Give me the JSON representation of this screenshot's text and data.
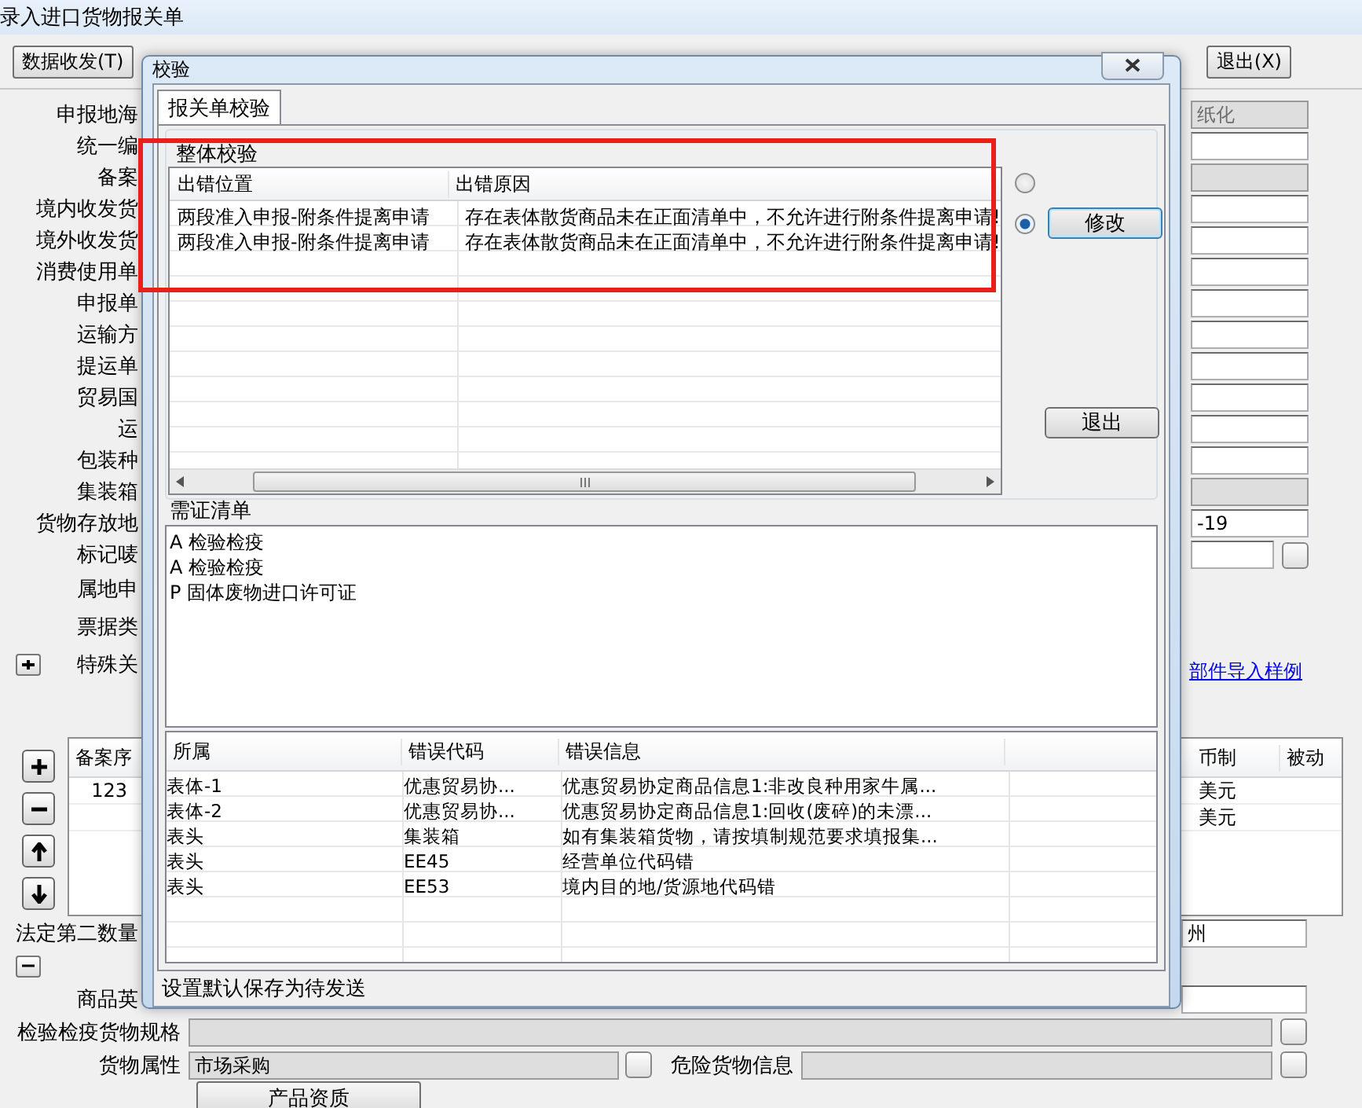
{
  "window": {
    "title": "录入进口货物报关单"
  },
  "toolbar": {
    "buttons": [
      {
        "label": "数据收发(T)"
      },
      {
        "label": "退出(X)"
      }
    ]
  },
  "form": {
    "labels": [
      "申报地海",
      "统一编",
      "备案",
      "境内收发货",
      "境外收发货",
      "消费使用单",
      "申报单",
      "运输方",
      "提运单",
      "贸易国",
      "运",
      "包装种",
      "集装箱",
      "货物存放地",
      "标记唛",
      "属地申",
      "票据类",
      "特殊关"
    ],
    "fields": [
      {
        "kind": "text",
        "value": "纸化",
        "disabled": true
      },
      {
        "kind": "text",
        "disabled": false
      },
      {
        "kind": "text",
        "disabled": true
      },
      {
        "kind": "text",
        "disabled": false
      },
      {
        "kind": "text",
        "disabled": false
      },
      {
        "kind": "text",
        "disabled": false
      },
      {
        "kind": "text",
        "disabled": false
      },
      {
        "kind": "text",
        "disabled": false
      },
      {
        "kind": "text",
        "disabled": false
      },
      {
        "kind": "text",
        "disabled": false
      },
      {
        "kind": "text",
        "disabled": false
      },
      {
        "kind": "text",
        "disabled": false
      },
      {
        "kind": "text",
        "disabled": true
      },
      {
        "kind": "text",
        "value": "-19",
        "disabled": false
      },
      {
        "kind": "lookup",
        "disabled": false
      }
    ],
    "link": "部件导入样例"
  },
  "goods_table": {
    "columns": [
      "备案序",
      "币制",
      "被动"
    ],
    "rows": [
      {
        "seq": "123",
        "currency": "美元"
      },
      {
        "currency": "美元"
      }
    ]
  },
  "lower": {
    "second_qty_label": "法定第二数量",
    "origin_value": "州",
    "english_label": "商品英",
    "spec_label": "检验检疫货物规格",
    "attr_label": "货物属性",
    "attr_value": "市场采购",
    "danger_label": "危险货物信息",
    "qualification_button": "产品资质"
  },
  "dialog": {
    "title": "校验",
    "tab": "报关单校验",
    "overall_group": "整体校验",
    "overall_columns": [
      "出错位置",
      "出错原因"
    ],
    "overall_rows": [
      {
        "location": "两段准入申报-附条件提离申请",
        "reason": "存在表体散货商品未在正面清单中，不允许进行附条件提离申请!"
      },
      {
        "location": "两段准入申报-附条件提离申请",
        "reason": "存在表体散货商品未在正面清单中，不允许进行附条件提离申请!"
      }
    ],
    "radios": [
      {
        "selected": false
      },
      {
        "selected": true,
        "button": "修改"
      }
    ],
    "exit_button": "退出",
    "cert_group": "需证清单",
    "cert_items": [
      "A 检验检疫",
      "A 检验检疫",
      "P 固体废物进口许可证"
    ],
    "error_columns": [
      "所属",
      "错误代码",
      "错误信息"
    ],
    "error_rows": [
      {
        "group": "表体-1",
        "code": "优惠贸易协...",
        "message": "优惠贸易协定商品信息1:非改良种用家牛属..."
      },
      {
        "group": "表体-2",
        "code": "优惠贸易协...",
        "message": "优惠贸易协定商品信息1:回收(废碎)的未漂..."
      },
      {
        "group": "表头",
        "code": "集装箱",
        "message": "如有集装箱货物，请按填制规范要求填报集..."
      },
      {
        "group": "表头",
        "code": "EE45",
        "message": "经营单位代码错"
      },
      {
        "group": "表头",
        "code": "EE53",
        "message": "境内目的地/货源地代码错"
      }
    ],
    "status": "设置默认保存为待发送"
  }
}
